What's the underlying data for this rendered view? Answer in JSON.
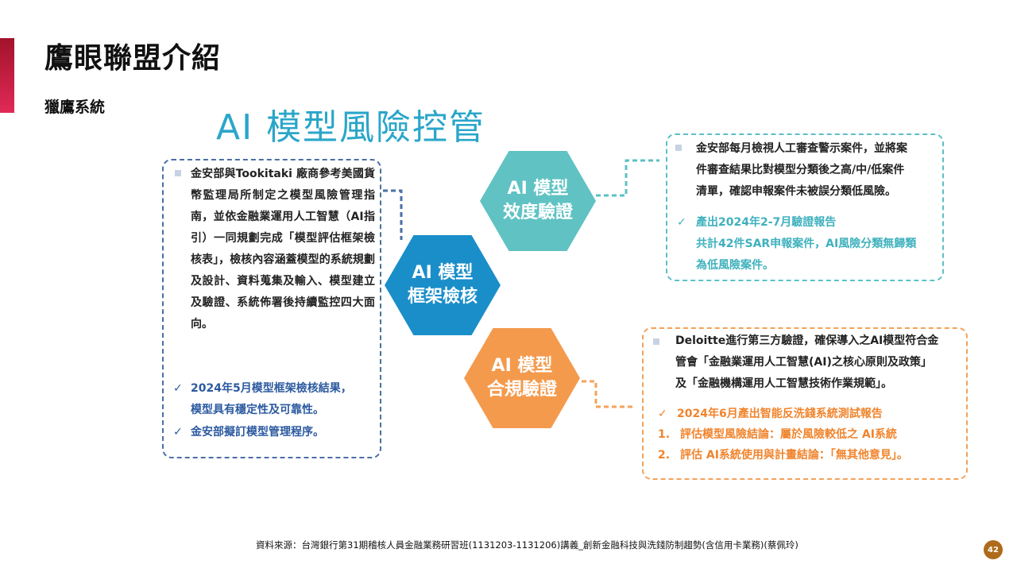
{
  "header": {
    "title": "鷹眼聯盟介紹",
    "subtitle": "獵鷹系統"
  },
  "section": {
    "title": "AI 模型風險控管"
  },
  "left_panel": {
    "text": "金安部與Tookitaki 廠商參考美國貨幣監理局所制定之模型風險管理指南，並依金融業運用人工智慧（AI指引）一同規劃完成「模型評估框架檢核表」，檢核內容涵蓋模型的系統規劃及設計、資料蒐集及輸入、模型建立及驗證、系統佈署後持續監控四大面向。",
    "check1_line1": "2024年5月模型框架檢核結果，",
    "check1_line2": "模型具有穩定性及可靠性。",
    "check2": "金安部擬訂模型管理程序。"
  },
  "hexagons": {
    "framework": {
      "line1": "AI 模型",
      "line2": "框架檢核"
    },
    "effectiveness": {
      "line1": "AI 模型",
      "line2": "效度驗證"
    },
    "compliance": {
      "line1": "AI 模型",
      "line2": "合規驗證"
    }
  },
  "top_right_panel": {
    "line1": "金安部每月檢視人工審查警示案件，並將案",
    "line2": "件審查結果比對模型分類後之高/中/低案件",
    "line3": "清單，確認申報案件未被誤分類低風險。",
    "check_line1": "產出2024年2-7月驗證報告",
    "check_line2": "共計42件SAR申報案件，AI風險分類無歸類",
    "check_line3": "為低風險案件。"
  },
  "bottom_right_panel": {
    "line1": "Deloitte進行第三方驗證，確保導入之AI模型符合金",
    "line2": "管會「金融業運用人工智慧(AI)之核心原則及政策」",
    "line3": "及「金融機構運用人工智慧技術作業規範」。",
    "check": "2024年6月產出智能反洗錢系統測試報告",
    "item1_num": "1.",
    "item1": "評估模型風險結論：屬於風險較低之 AI系統",
    "item2_num": "2.",
    "item2": "評估 AI系統使用與計畫結論：「無其他意見」。"
  },
  "footer": {
    "source": "資料來源：台灣銀行第31期稽核人員金融業務研習班(1131203-1131206)講義_創新金融科技與洗錢防制趨勢(含信用卡業務)(蔡佩玲)",
    "page": "42"
  },
  "colors": {
    "accent": "#c41e45",
    "title_blue": "#2aa6c9",
    "hex_blue": "#1a8ec9",
    "hex_teal": "#60c2c3",
    "hex_orange": "#f49a4d",
    "check_blue": "#2c5aa0",
    "check_teal": "#3fb1bd",
    "check_orange": "#f0842c"
  },
  "icons": {
    "bullet": "square-bullet-icon",
    "check": "check-mark-icon"
  }
}
